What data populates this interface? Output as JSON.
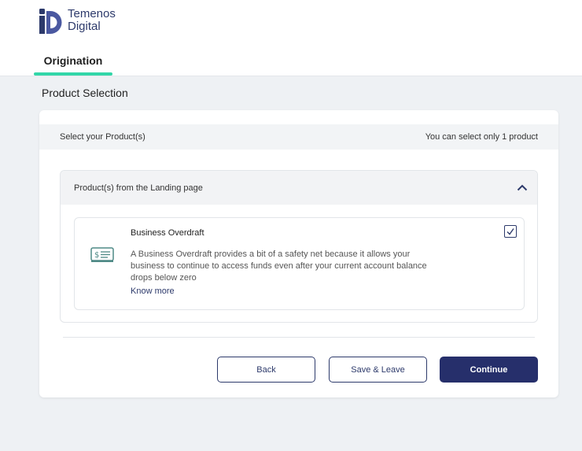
{
  "brand": {
    "line1": "Temenos",
    "line2": "Digital",
    "accent_color": "#32d6a8",
    "primary_color": "#262f6b"
  },
  "nav": {
    "active_tab": "Origination"
  },
  "page": {
    "title": "Product Selection"
  },
  "selection": {
    "header_left": "Select your Product(s)",
    "header_right": "You can select only 1 product",
    "group_label": "Product(s) from the Landing page",
    "group_state": "expanded",
    "products": [
      {
        "name": "Business Overdraft",
        "description": "A Business Overdraft provides a bit of a safety net because it allows your business to continue to access funds even after your current account balance drops below zero",
        "link": "Know more",
        "icon": "cheque-icon",
        "selected": true
      }
    ]
  },
  "actions": {
    "back": "Back",
    "save_leave": "Save & Leave",
    "continue": "Continue"
  }
}
